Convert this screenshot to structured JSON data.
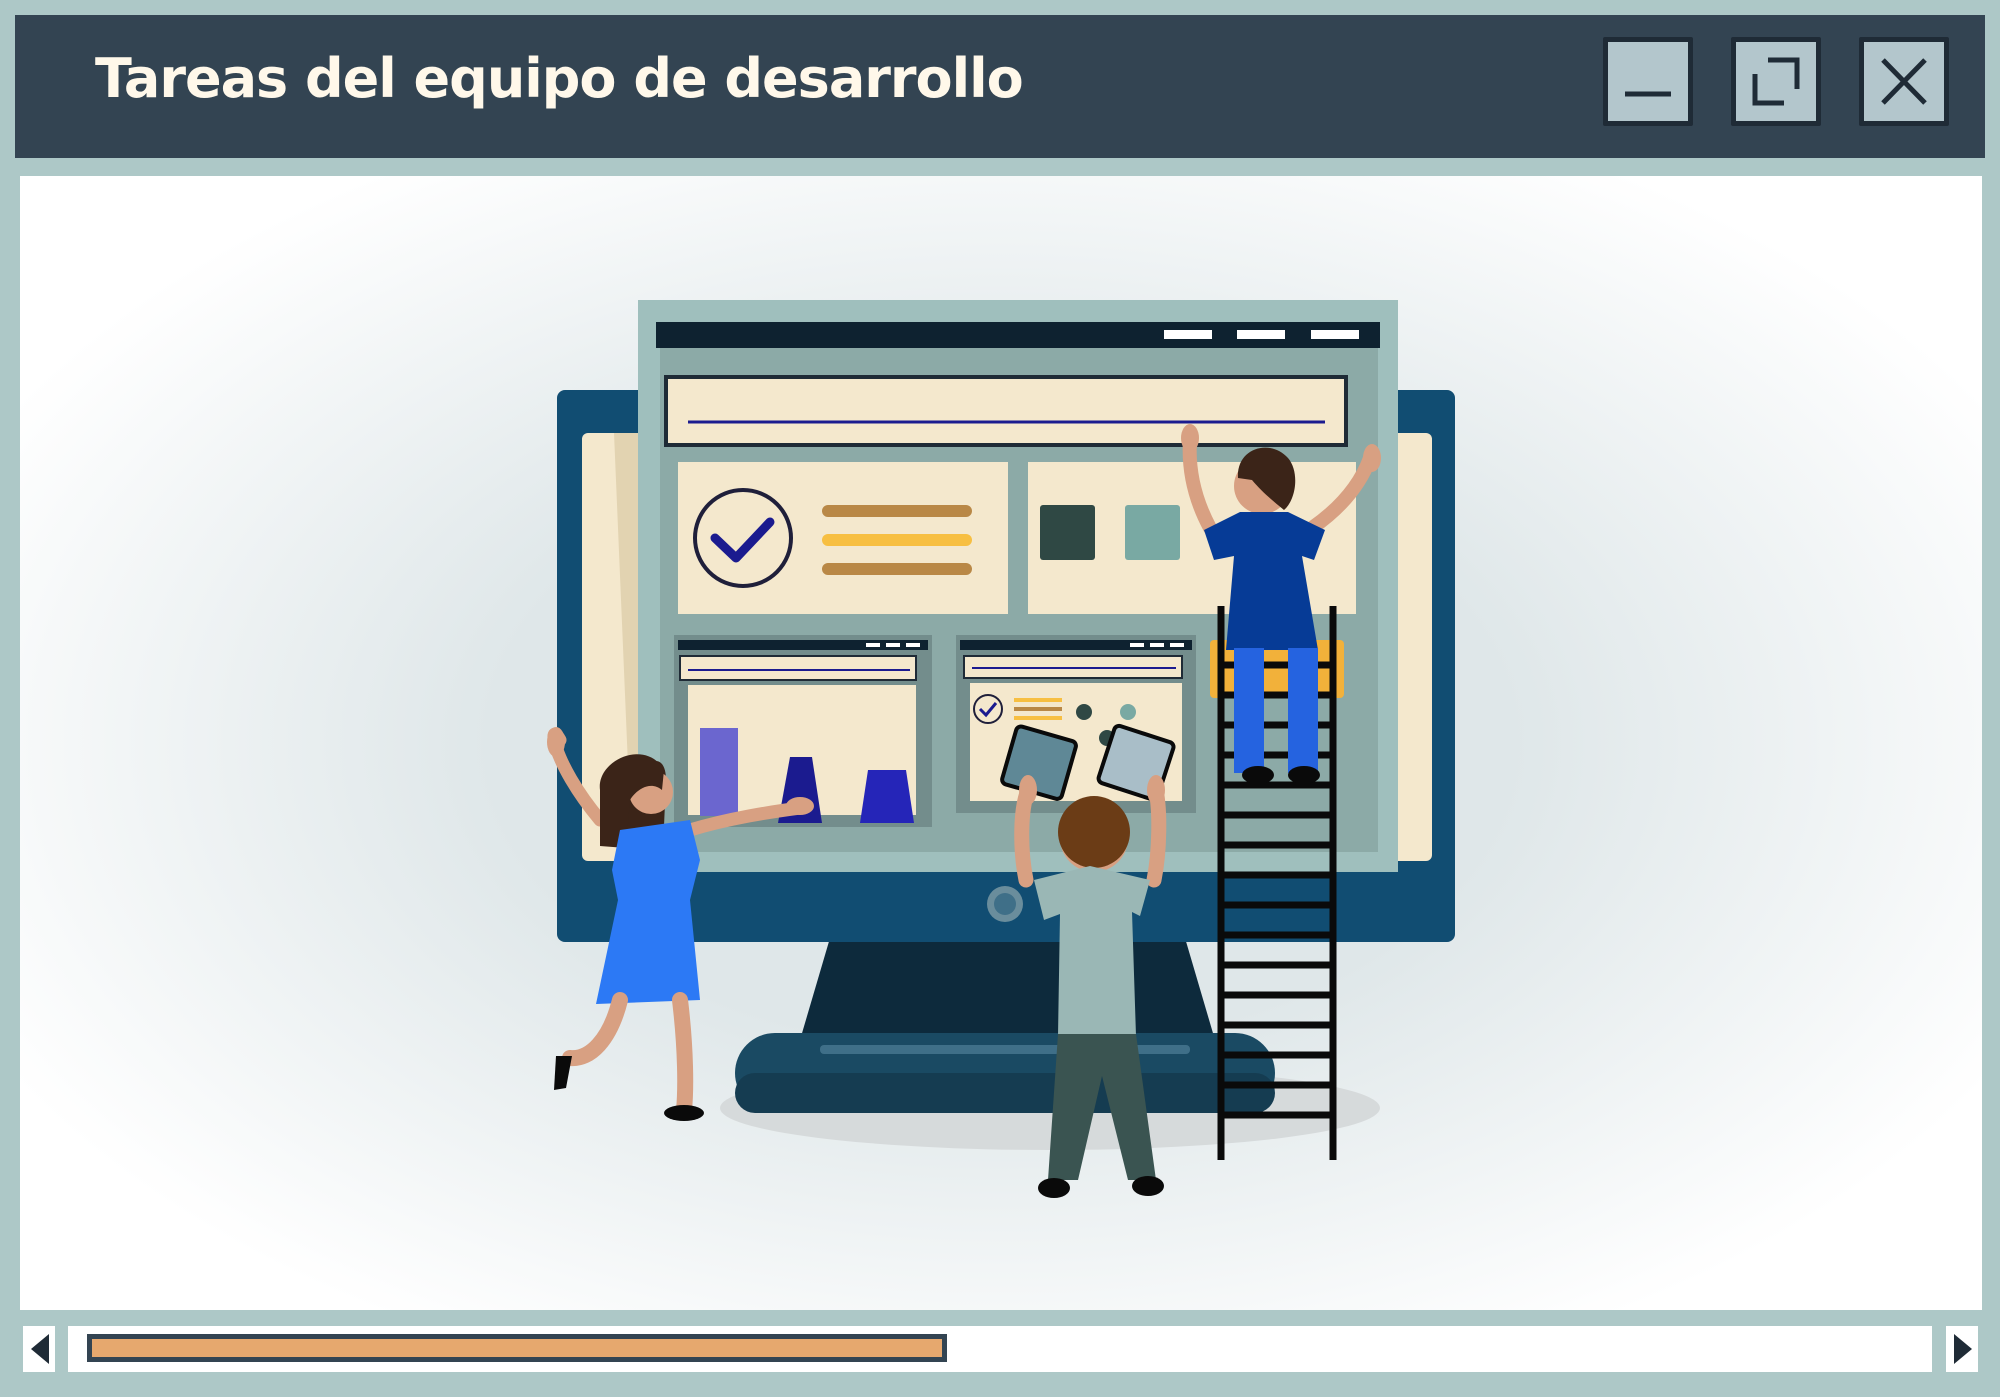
{
  "window": {
    "title": "Tareas del equipo de desarrollo",
    "controls": {
      "minimize_icon": "minimize-icon",
      "restore_icon": "restore-icon",
      "close_icon": "close-icon"
    }
  },
  "scrollbar": {
    "orientation": "horizontal",
    "position_fraction": 0.44,
    "left_arrow_icon": "triangle-left-icon",
    "right_arrow_icon": "triangle-right-icon"
  },
  "colors": {
    "titlebar": "#334452",
    "frame": "#adc8c7",
    "title_text": "#fff8ea",
    "scroll_thumb": "#e6a86e"
  }
}
